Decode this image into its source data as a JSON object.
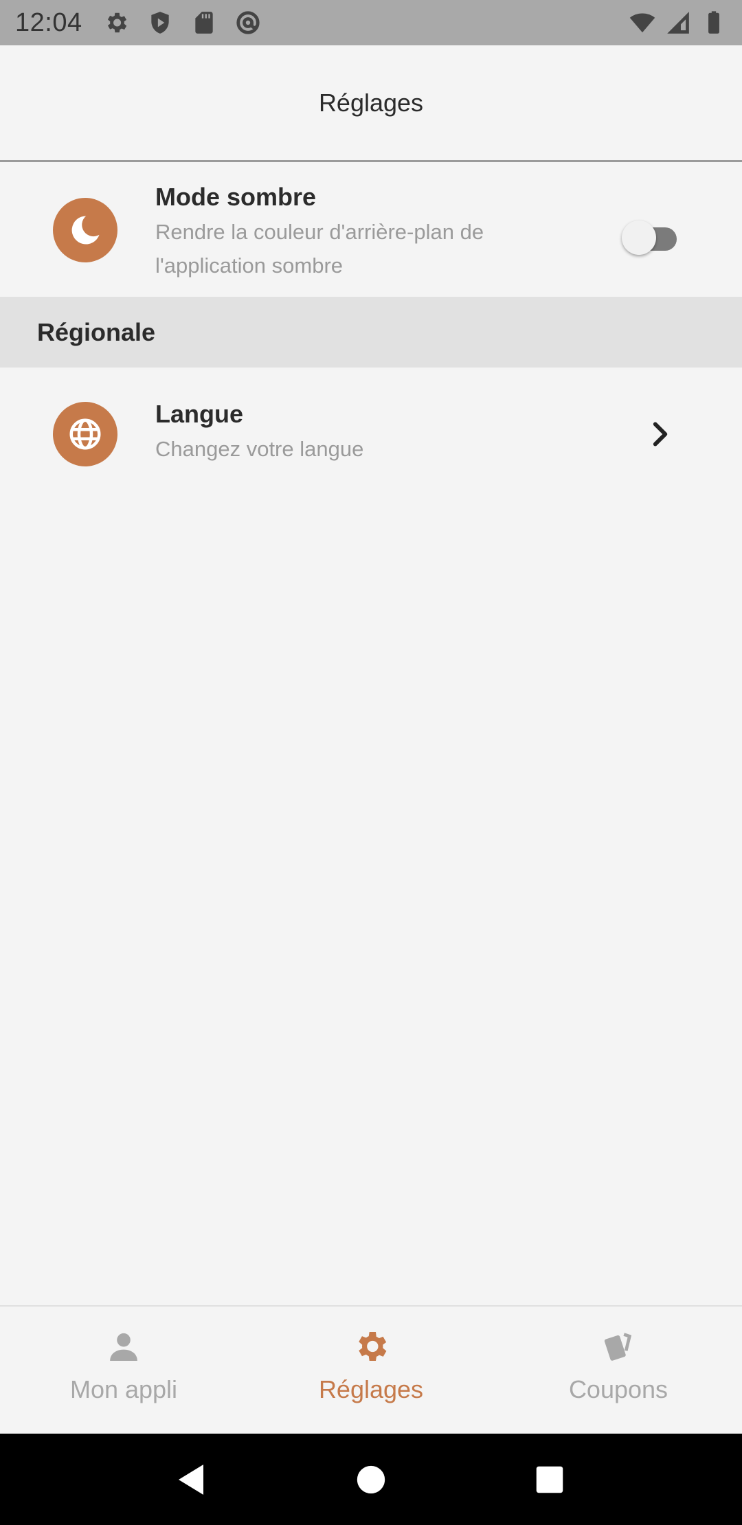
{
  "status_bar": {
    "time": "12:04",
    "left_icons": [
      "gear-icon",
      "shield-play-icon",
      "sd-card-icon",
      "at-sign-icon"
    ],
    "right_icons": [
      "wifi-icon",
      "signal-icon",
      "battery-icon"
    ]
  },
  "header": {
    "title": "Réglages"
  },
  "settings": {
    "dark_mode": {
      "title": "Mode sombre",
      "subtitle": "Rendre la couleur d'arrière-plan de l'application sombre",
      "icon": "moon-icon",
      "enabled": false
    },
    "section_regional": "Régionale",
    "language": {
      "title": "Langue",
      "subtitle": "Changez votre langue",
      "icon": "globe-icon"
    }
  },
  "bottom_nav": {
    "items": [
      {
        "label": "Mon appli",
        "icon": "person-icon",
        "active": false
      },
      {
        "label": "Réglages",
        "icon": "settings-gear-icon",
        "active": true
      },
      {
        "label": "Coupons",
        "icon": "coupons-icon",
        "active": false
      }
    ]
  },
  "colors": {
    "accent": "#c67a4a",
    "inactive": "#a8a8a8",
    "background": "#f4f4f4",
    "section_background": "#e1e1e1"
  }
}
